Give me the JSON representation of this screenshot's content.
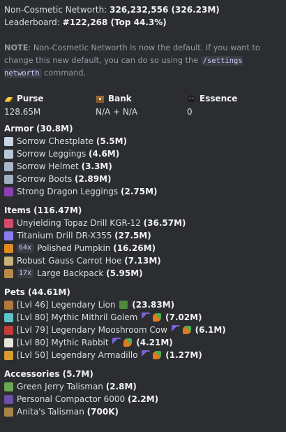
{
  "header": {
    "networth_label": "Non-Cosmetic Networth:",
    "networth_value": "326,232,556 (326.23M)",
    "leaderboard_label": "Leaderboard:",
    "leaderboard_value": "#122,268 (Top 44.3%)"
  },
  "note": {
    "label": "NOTE",
    "text_before": ": Non-Cosmetic Networth is now the default. If you want to change this new default, you can do so using the ",
    "command": "/settings networth",
    "text_after": " command."
  },
  "fields": {
    "purse": {
      "label": "Purse",
      "value": "128.65M",
      "icon": "gold-ingot-icon"
    },
    "bank": {
      "label": "Bank",
      "value": "N/A + N/A",
      "icon": "chest-icon"
    },
    "essence": {
      "label": "Essence",
      "value": "0",
      "icon": "wither-essence-icon"
    }
  },
  "armor": {
    "title": "Armor (30.8M)",
    "items": [
      {
        "name": "Sorrow Chestplate",
        "value": "(5.5M)",
        "icon": "chestplate-icon",
        "color": "#c9d6e3"
      },
      {
        "name": "Sorrow Leggings",
        "value": "(4.6M)",
        "icon": "leggings-icon",
        "color": "#b9c8d6"
      },
      {
        "name": "Sorrow Helmet",
        "value": "(3.3M)",
        "icon": "helmet-icon",
        "color": "#a7b8c9"
      },
      {
        "name": "Sorrow Boots",
        "value": "(2.89M)",
        "icon": "boots-icon",
        "color": "#9fb0c2"
      },
      {
        "name": "Strong Dragon Leggings",
        "value": "(2.75M)",
        "icon": "dragon-leggings-icon",
        "color": "#8a3fb5"
      }
    ]
  },
  "items": {
    "title": "Items (116.47M)",
    "items": [
      {
        "name": "Unyielding Topaz Drill KGR-12",
        "value": "(36.57M)",
        "icon": "drill-icon",
        "color": "#d44a6a",
        "badge": ""
      },
      {
        "name": "Titanium Drill DR-X355",
        "value": "(27.5M)",
        "icon": "drill-icon",
        "color": "#8a7cf0",
        "badge": ""
      },
      {
        "name": "Polished Pumpkin",
        "value": "(16.26M)",
        "icon": "pumpkin-icon",
        "color": "#e08a1e",
        "badge": "64x"
      },
      {
        "name": "Robust Gauss Carrot Hoe",
        "value": "(7.13M)",
        "icon": "hoe-icon",
        "color": "#c9b27a",
        "badge": ""
      },
      {
        "name": "Large Backpack",
        "value": "(5.95M)",
        "icon": "backpack-icon",
        "color": "#b88a4a",
        "badge": "17x"
      }
    ]
  },
  "pets": {
    "title": "Pets (44.61M)",
    "items": [
      {
        "name": "[Lvl 46] Legendary Lion",
        "value": "(23.83M)",
        "icon": "lion-icon",
        "color": "#b07a3a",
        "extras": [
          "green-block-icon"
        ]
      },
      {
        "name": "[Lvl 80] Mythic Mithril Golem",
        "value": "(7.02M)",
        "icon": "golem-icon",
        "color": "#5fc4c8",
        "extras": [
          "pickaxe-icon",
          "carrot-icon"
        ]
      },
      {
        "name": "[Lvl 79] Legendary Mooshroom Cow",
        "value": "(6.1M)",
        "icon": "mooshroom-icon",
        "color": "#c23a3a",
        "extras": [
          "pickaxe-icon",
          "carrot-icon"
        ]
      },
      {
        "name": "[Lvl 80] Mythic Rabbit",
        "value": "(4.21M)",
        "icon": "rabbit-icon",
        "color": "#e8e4dc",
        "extras": [
          "pickaxe-icon",
          "carrot-icon"
        ]
      },
      {
        "name": "[Lvl 50] Legendary Armadillo",
        "value": "(1.27M)",
        "icon": "armadillo-icon",
        "color": "#d99a2e",
        "extras": [
          "pickaxe-icon",
          "carrot-icon"
        ]
      }
    ]
  },
  "accessories": {
    "title": "Accessories (5.7M)",
    "items": [
      {
        "name": "Green Jerry Talisman",
        "value": "(2.8M)",
        "icon": "green-jerry-icon",
        "color": "#6aa84f"
      },
      {
        "name": "Personal Compactor 6000",
        "value": "(2.2M)",
        "icon": "compactor-icon",
        "color": "#6b4fa8"
      },
      {
        "name": "Anita's Talisman",
        "value": "(700K)",
        "icon": "anita-talisman-icon",
        "color": "#a8834a"
      }
    ]
  },
  "colors": {
    "background": "#2b2d31",
    "text": "#dbdee1",
    "muted": "#949ba4",
    "code_bg": "#3a3c44",
    "code_fg": "#c9cdfb",
    "pickaxe": "#7b63d6",
    "carrot": "#e07b22"
  }
}
